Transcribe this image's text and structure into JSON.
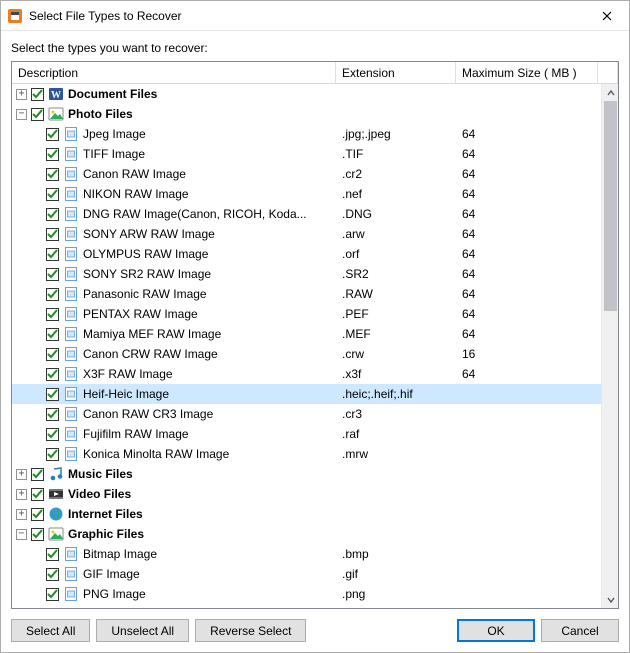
{
  "window": {
    "title": "Select File Types to Recover",
    "prompt": "Select the types you want to recover:"
  },
  "columns": {
    "description": "Description",
    "extension": "Extension",
    "maxsize": "Maximum Size ( MB )"
  },
  "buttons": {
    "select_all": "Select All",
    "unselect_all": "Unselect All",
    "reverse_select": "Reverse Select",
    "ok": "OK",
    "cancel": "Cancel"
  },
  "tree": [
    {
      "kind": "cat",
      "expand": "+",
      "icon": "word",
      "label": "Document Files"
    },
    {
      "kind": "cat",
      "expand": "-",
      "icon": "picture",
      "label": "Photo Files"
    },
    {
      "kind": "item",
      "label": "Jpeg Image",
      "ext": ".jpg;.jpeg",
      "size": "64"
    },
    {
      "kind": "item",
      "label": "TIFF Image",
      "ext": ".TIF",
      "size": "64"
    },
    {
      "kind": "item",
      "label": "Canon RAW Image",
      "ext": ".cr2",
      "size": "64"
    },
    {
      "kind": "item",
      "label": "NIKON RAW Image",
      "ext": ".nef",
      "size": "64"
    },
    {
      "kind": "item",
      "label": "DNG RAW Image(Canon, RICOH, Koda...",
      "ext": ".DNG",
      "size": "64"
    },
    {
      "kind": "item",
      "label": "SONY ARW RAW Image",
      "ext": ".arw",
      "size": "64"
    },
    {
      "kind": "item",
      "label": "OLYMPUS RAW Image",
      "ext": ".orf",
      "size": "64"
    },
    {
      "kind": "item",
      "label": "SONY SR2 RAW Image",
      "ext": ".SR2",
      "size": "64"
    },
    {
      "kind": "item",
      "label": "Panasonic RAW Image",
      "ext": ".RAW",
      "size": "64"
    },
    {
      "kind": "item",
      "label": "PENTAX RAW Image",
      "ext": ".PEF",
      "size": "64"
    },
    {
      "kind": "item",
      "label": "Mamiya MEF RAW Image",
      "ext": ".MEF",
      "size": "64"
    },
    {
      "kind": "item",
      "label": "Canon CRW RAW Image",
      "ext": ".crw",
      "size": "16"
    },
    {
      "kind": "item",
      "label": "X3F RAW Image",
      "ext": ".x3f",
      "size": "64"
    },
    {
      "kind": "item",
      "label": "Heif-Heic Image",
      "ext": ".heic;.heif;.hif",
      "size": "",
      "selected": true
    },
    {
      "kind": "item",
      "label": "Canon RAW CR3 Image",
      "ext": ".cr3",
      "size": ""
    },
    {
      "kind": "item",
      "label": "Fujifilm RAW Image",
      "ext": ".raf",
      "size": ""
    },
    {
      "kind": "item",
      "label": "Konica Minolta RAW Image",
      "ext": ".mrw",
      "size": "",
      "last": true
    },
    {
      "kind": "cat",
      "expand": "+",
      "icon": "music",
      "label": "Music Files"
    },
    {
      "kind": "cat",
      "expand": "+",
      "icon": "video",
      "label": "Video Files"
    },
    {
      "kind": "cat",
      "expand": "+",
      "icon": "globe",
      "label": "Internet Files"
    },
    {
      "kind": "cat",
      "expand": "-",
      "icon": "picture",
      "label": "Graphic Files"
    },
    {
      "kind": "item",
      "label": "Bitmap Image",
      "ext": ".bmp",
      "size": ""
    },
    {
      "kind": "item",
      "label": "GIF Image",
      "ext": ".gif",
      "size": ""
    },
    {
      "kind": "item",
      "label": "PNG Image",
      "ext": ".png",
      "size": ""
    }
  ]
}
